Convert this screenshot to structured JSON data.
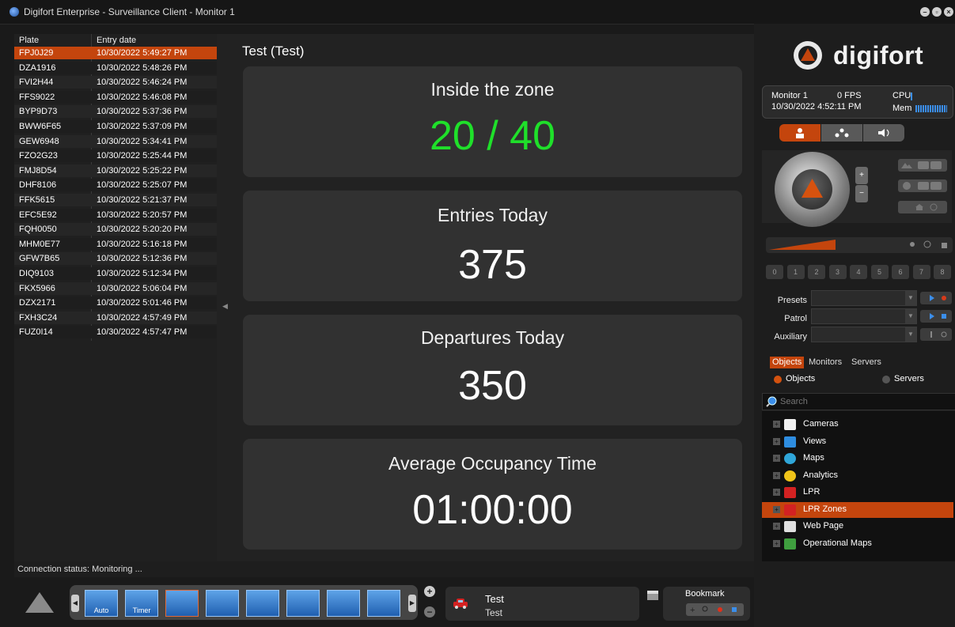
{
  "window": {
    "title": "Digifort Enterprise - Surveillance Client - Monitor 1",
    "minimize_glyph": "–",
    "maximize_glyph": "▫",
    "close_glyph": "×"
  },
  "plates": {
    "headers": {
      "plate": "Plate",
      "entry_date": "Entry date"
    },
    "rows": [
      {
        "plate": "FPJ0J29",
        "date": "10/30/2022 5:49:27 PM"
      },
      {
        "plate": "DZA1916",
        "date": "10/30/2022 5:48:26 PM"
      },
      {
        "plate": "FVI2H44",
        "date": "10/30/2022 5:46:24 PM"
      },
      {
        "plate": "FFS9022",
        "date": "10/30/2022 5:46:08 PM"
      },
      {
        "plate": "BYP9D73",
        "date": "10/30/2022 5:37:36 PM"
      },
      {
        "plate": "BWW6F65",
        "date": "10/30/2022 5:37:09 PM"
      },
      {
        "plate": "GEW6948",
        "date": "10/30/2022 5:34:41 PM"
      },
      {
        "plate": "FZO2G23",
        "date": "10/30/2022 5:25:44 PM"
      },
      {
        "plate": "FMJ8D54",
        "date": "10/30/2022 5:25:22 PM"
      },
      {
        "plate": "DHF8106",
        "date": "10/30/2022 5:25:07 PM"
      },
      {
        "plate": "FFK5615",
        "date": "10/30/2022 5:21:37 PM"
      },
      {
        "plate": "EFC5E92",
        "date": "10/30/2022 5:20:57 PM"
      },
      {
        "plate": "FQH0050",
        "date": "10/30/2022 5:20:20 PM"
      },
      {
        "plate": "MHM0E77",
        "date": "10/30/2022 5:16:18 PM"
      },
      {
        "plate": "GFW7B65",
        "date": "10/30/2022 5:12:36 PM"
      },
      {
        "plate": "DIQ9103",
        "date": "10/30/2022 5:12:34 PM"
      },
      {
        "plate": "FKX5966",
        "date": "10/30/2022 5:06:04 PM"
      },
      {
        "plate": "DZX2171",
        "date": "10/30/2022 5:01:46 PM"
      },
      {
        "plate": "FXH3C24",
        "date": "10/30/2022 4:57:49 PM"
      },
      {
        "plate": "FUZ0I14",
        "date": "10/30/2022 4:57:47 PM"
      }
    ]
  },
  "status": {
    "connection": "Connection status: Monitoring ..."
  },
  "view": {
    "title": "Test (Test)",
    "cards": [
      {
        "label": "Inside the zone",
        "value": "20 / 40",
        "color": "#1fe02a"
      },
      {
        "label": "Entries Today",
        "value": "375",
        "color": "#ffffff"
      },
      {
        "label": "Departures Today",
        "value": "350",
        "color": "#ffffff"
      },
      {
        "label": "Average Occupancy Time",
        "value": "01:00:00",
        "color": "#ffffff"
      }
    ]
  },
  "brand": {
    "name": "digifort",
    "accent": "#c4450d"
  },
  "monitor_info": {
    "monitor": "Monitor 1",
    "fps": "0 FPS",
    "cpu": "CPU",
    "datetime": "10/30/2022 4:52:11 PM",
    "mem": "Mem"
  },
  "ptz": {
    "numkeys": [
      "0",
      "1",
      "2",
      "3",
      "4",
      "5",
      "6",
      "7",
      "8"
    ],
    "zoom_in": "+",
    "zoom_out": "−",
    "presets_label": "Presets",
    "patrol_label": "Patrol",
    "auxiliary_label": "Auxiliary"
  },
  "tabs": {
    "objects": "Objects",
    "monitors": "Monitors",
    "servers": "Servers"
  },
  "radios": {
    "objects": "Objects",
    "servers": "Servers"
  },
  "search": {
    "placeholder": "Search"
  },
  "tree": [
    {
      "label": "Cameras",
      "icon": "camera-icon"
    },
    {
      "label": "Views",
      "icon": "views-icon"
    },
    {
      "label": "Maps",
      "icon": "globe-icon"
    },
    {
      "label": "Analytics",
      "icon": "pie-chart-icon"
    },
    {
      "label": "LPR",
      "icon": "car-icon"
    },
    {
      "label": "LPR Zones",
      "icon": "car-zone-icon",
      "selected": true
    },
    {
      "label": "Web Page",
      "icon": "web-page-icon"
    },
    {
      "label": "Operational Maps",
      "icon": "operational-map-icon"
    }
  ],
  "bottom": {
    "layouts": [
      {
        "label": "Auto"
      },
      {
        "label": "Timer"
      },
      {
        "label": ""
      },
      {
        "label": ""
      },
      {
        "label": ""
      },
      {
        "label": ""
      },
      {
        "label": ""
      },
      {
        "label": ""
      }
    ],
    "camera_name": "Test",
    "camera_desc": "Test",
    "bookmark_label": "Bookmark"
  }
}
